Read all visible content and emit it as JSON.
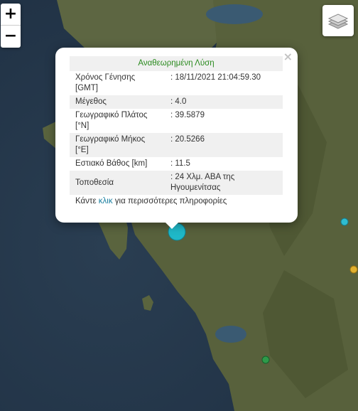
{
  "map": {
    "zoom_in_label": "+",
    "zoom_out_label": "−",
    "layers_icon": "layers-icon",
    "colors": {
      "sea": "#26384a",
      "land": "#56603a",
      "main_event_marker": "#1fb8c8",
      "marker_cyan": "#2fbcd0",
      "marker_yellow": "#e0b030",
      "marker_green": "#2e9a4a"
    }
  },
  "popup": {
    "header": "Αναθεωρημένη Λύση",
    "close_label": "×",
    "rows": [
      {
        "label": "Χρόνος Γένησης [GMT]",
        "value": ": 18/11/2021 21:04:59.30"
      },
      {
        "label": "Μέγεθος",
        "value": ": 4.0"
      },
      {
        "label": "Γεωγραφικό Πλάτος [°N]",
        "value": ": 39.5879"
      },
      {
        "label": "Γεωγραφικό Μήκος [°E]",
        "value": ": 20.5266"
      },
      {
        "label": "Εστιακό Βάθος [km]",
        "value": ": 11.5"
      },
      {
        "label": "Τοποθεσία",
        "value": ": 24 Χλμ. ΑΒΑ της Ηγουμενίτσας"
      }
    ],
    "more_prefix": "Κάντε ",
    "more_link": "κλικ",
    "more_suffix": " για περισσότερες πληροφορίες"
  }
}
